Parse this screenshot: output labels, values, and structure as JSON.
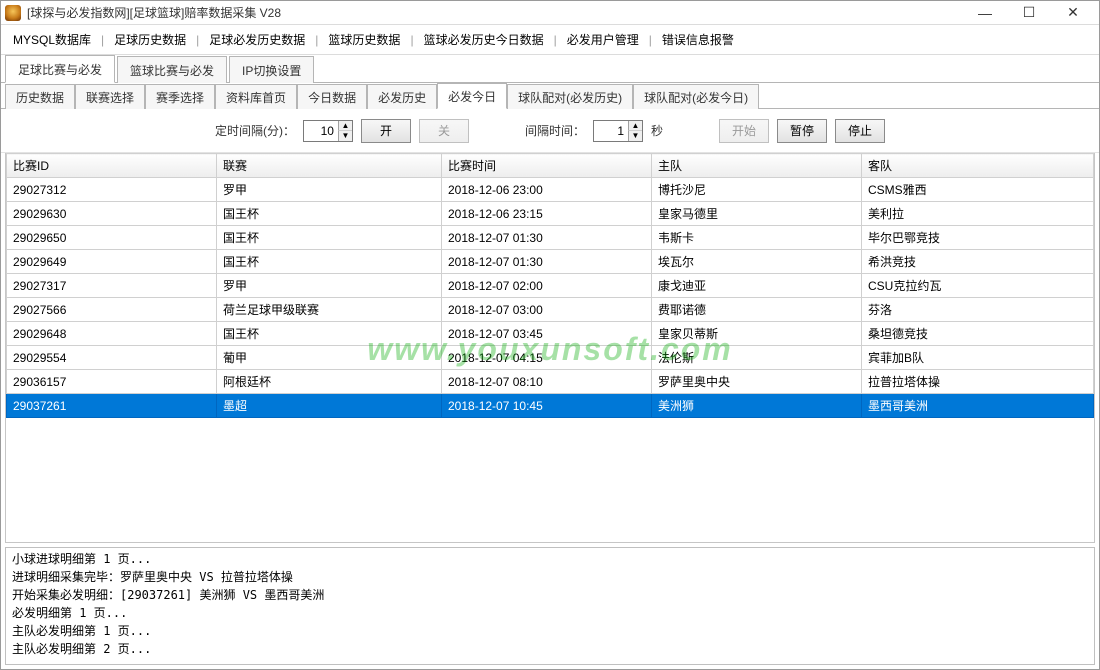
{
  "window": {
    "title": "[球探与必发指数网][足球篮球]赔率数据采集 V28"
  },
  "menu": [
    "MYSQL数据库",
    "足球历史数据",
    "足球必发历史数据",
    "篮球历史数据",
    "篮球必发历史今日数据",
    "必发用户管理",
    "错误信息报警"
  ],
  "main_tabs": [
    "足球比赛与必发",
    "篮球比赛与必发",
    "IP切换设置"
  ],
  "main_tab_active": 0,
  "sub_tabs": [
    "历史数据",
    "联赛选择",
    "赛季选择",
    "资料库首页",
    "今日数据",
    "必发历史",
    "必发今日",
    "球队配对(必发历史)",
    "球队配对(必发今日)"
  ],
  "sub_tab_active": 6,
  "controls": {
    "timer_label": "定时间隔(分)：",
    "timer_value": "10",
    "open": "开",
    "close": "关",
    "interval_label": "间隔时间：",
    "interval_value": "1",
    "interval_unit": "秒",
    "start": "开始",
    "pause": "暂停",
    "stop": "停止"
  },
  "columns": [
    "比赛ID",
    "联赛",
    "比赛时间",
    "主队",
    "客队"
  ],
  "rows": [
    {
      "id": "29027312",
      "league": "罗甲",
      "time": "2018-12-06 23:00",
      "home": "博托沙尼",
      "away": "CSMS雅西",
      "sel": false
    },
    {
      "id": "29029630",
      "league": "国王杯",
      "time": "2018-12-06 23:15",
      "home": "皇家马德里",
      "away": "美利拉",
      "sel": false
    },
    {
      "id": "29029650",
      "league": "国王杯",
      "time": "2018-12-07 01:30",
      "home": "韦斯卡",
      "away": "毕尔巴鄂竞技",
      "sel": false
    },
    {
      "id": "29029649",
      "league": "国王杯",
      "time": "2018-12-07 01:30",
      "home": "埃瓦尔",
      "away": "希洪竞技",
      "sel": false
    },
    {
      "id": "29027317",
      "league": "罗甲",
      "time": "2018-12-07 02:00",
      "home": "康戈迪亚",
      "away": "CSU克拉约瓦",
      "sel": false
    },
    {
      "id": "29027566",
      "league": "荷兰足球甲级联赛",
      "time": "2018-12-07 03:00",
      "home": "费耶诺德",
      "away": "芬洛",
      "sel": false
    },
    {
      "id": "29029648",
      "league": "国王杯",
      "time": "2018-12-07 03:45",
      "home": "皇家贝蒂斯",
      "away": "桑坦德竞技",
      "sel": false
    },
    {
      "id": "29029554",
      "league": "葡甲",
      "time": "2018-12-07 04:15",
      "home": "法伦斯",
      "away": "宾菲加B队",
      "sel": false
    },
    {
      "id": "29036157",
      "league": "阿根廷杯",
      "time": "2018-12-07 08:10",
      "home": "罗萨里奥中央",
      "away": "拉普拉塔体操",
      "sel": false
    },
    {
      "id": "29037261",
      "league": "墨超",
      "time": "2018-12-07 10:45",
      "home": "美洲狮",
      "away": "墨西哥美洲",
      "sel": true
    }
  ],
  "log": [
    "小球进球明细第 1 页...",
    "进球明细采集完毕：罗萨里奥中央 VS 拉普拉塔体操",
    "开始采集必发明细：[29037261] 美洲狮 VS 墨西哥美洲",
    "必发明细第 1 页...",
    "主队必发明细第 1 页...",
    "主队必发明细第 2 页..."
  ],
  "watermark": "www.youxunsoft.com"
}
